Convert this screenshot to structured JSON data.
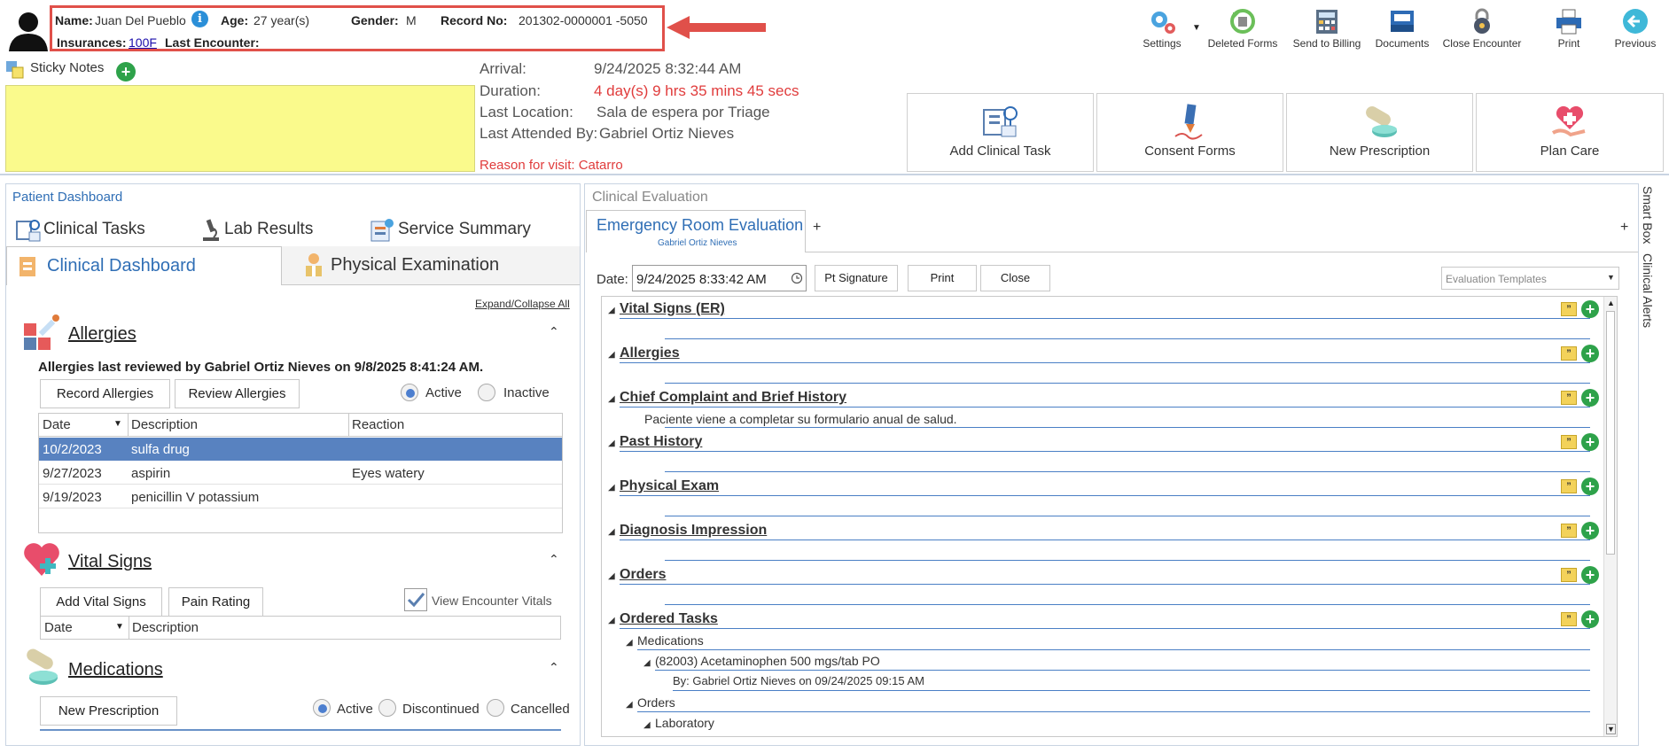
{
  "patient": {
    "name_label": "Name:",
    "name": "Juan Del Pueblo",
    "age_label": "Age:",
    "age": "27 year(s)",
    "gender_label": "Gender:",
    "gender": "M",
    "record_label": "Record No:",
    "record_no": "201302-0000001 -5050",
    "insurances_label": "Insurances:",
    "insurance": "100F",
    "last_encounter_label": "Last Encounter:",
    "info_glyph": "i"
  },
  "toolbar": [
    {
      "label": "Settings",
      "icon": "gear-icon"
    },
    {
      "label": "Deleted Forms",
      "icon": "recycle-icon"
    },
    {
      "label": "Send to Billing",
      "icon": "calculator-icon"
    },
    {
      "label": "Documents",
      "icon": "documents-icon"
    },
    {
      "label": "Close Encounter",
      "icon": "lock-icon"
    },
    {
      "label": "Print",
      "icon": "printer-icon"
    },
    {
      "label": "Previous",
      "icon": "back-arrow-icon"
    }
  ],
  "sticky": {
    "title": "Sticky Notes",
    "add_glyph": "+"
  },
  "encounter": {
    "arrival_label": "Arrival:",
    "arrival": "9/24/2025 8:32:44 AM",
    "duration_label": "Duration:",
    "duration": "4 day(s) 9 hrs 35 mins 45 secs",
    "location_label": "Last Location:",
    "location": "Sala de espera por Triage",
    "attended_label": "Last Attended By:",
    "attended": "Gabriel Ortiz Nieves",
    "reason": "Reason for visit: Catarro"
  },
  "actions": [
    "Add Clinical Task",
    "Consent Forms",
    "New Prescription",
    "Plan Care"
  ],
  "left": {
    "title": "Patient Dashboard",
    "tabs_top": [
      "Clinical Tasks",
      "Lab Results",
      "Service Summary"
    ],
    "tab_active": "Clinical Dashboard",
    "tab_other": "Physical Examination",
    "expand_all": "Expand/Collapse All",
    "allergies": {
      "title": "Allergies",
      "reviewed": "Allergies last reviewed by Gabriel Ortiz Nieves on 9/8/2025 8:41:24 AM.",
      "record_btn": "Record Allergies",
      "review_btn": "Review Allergies",
      "active": "Active",
      "inactive": "Inactive",
      "headers": [
        "Date",
        "Description",
        "Reaction"
      ],
      "rows": [
        {
          "date": "10/2/2023",
          "desc": "sulfa drug",
          "reaction": ""
        },
        {
          "date": "9/27/2023",
          "desc": "aspirin",
          "reaction": "Eyes watery"
        },
        {
          "date": "9/19/2023",
          "desc": "penicillin V potassium",
          "reaction": ""
        }
      ]
    },
    "vitals": {
      "title": "Vital Signs",
      "add_btn": "Add Vital Signs",
      "pain_btn": "Pain Rating",
      "view_label": "View Encounter Vitals",
      "headers": [
        "Date",
        "Description"
      ]
    },
    "medications": {
      "title": "Medications",
      "new_btn": "New Prescription",
      "active": "Active",
      "discontinued": "Discontinued",
      "cancelled": "Cancelled"
    }
  },
  "right": {
    "title": "Clinical Evaluation",
    "tab": "Emergency Room Evaluation",
    "tab_sub": "Gabriel Ortiz Nieves",
    "add_tab": "+",
    "date_label": "Date:",
    "date_value": "9/24/2025 8:33:42 AM",
    "signature_btn": "Pt Signature",
    "print_btn": "Print",
    "close_btn": "Close",
    "templates_placeholder": "Evaluation Templates",
    "sections": [
      {
        "title": "Vital Signs (ER)"
      },
      {
        "title": "Allergies"
      },
      {
        "title": "Chief Complaint and Brief History",
        "note": "Paciente viene a completar su formulario anual de salud."
      },
      {
        "title": "Past History"
      },
      {
        "title": "Physical Exam"
      },
      {
        "title": "Diagnosis Impression"
      },
      {
        "title": "Orders"
      },
      {
        "title": "Ordered Tasks"
      }
    ],
    "ordered": {
      "medications": "Medications",
      "med_item": "(82003) Acetaminophen 500 mgs/tab PO",
      "med_by": "By: Gabriel Ortiz Nieves on 09/24/2025 09:15 AM",
      "orders": "Orders",
      "laboratory": "Laboratory"
    },
    "side_tabs": [
      "Smart Box",
      "Clinical Alerts"
    ]
  }
}
